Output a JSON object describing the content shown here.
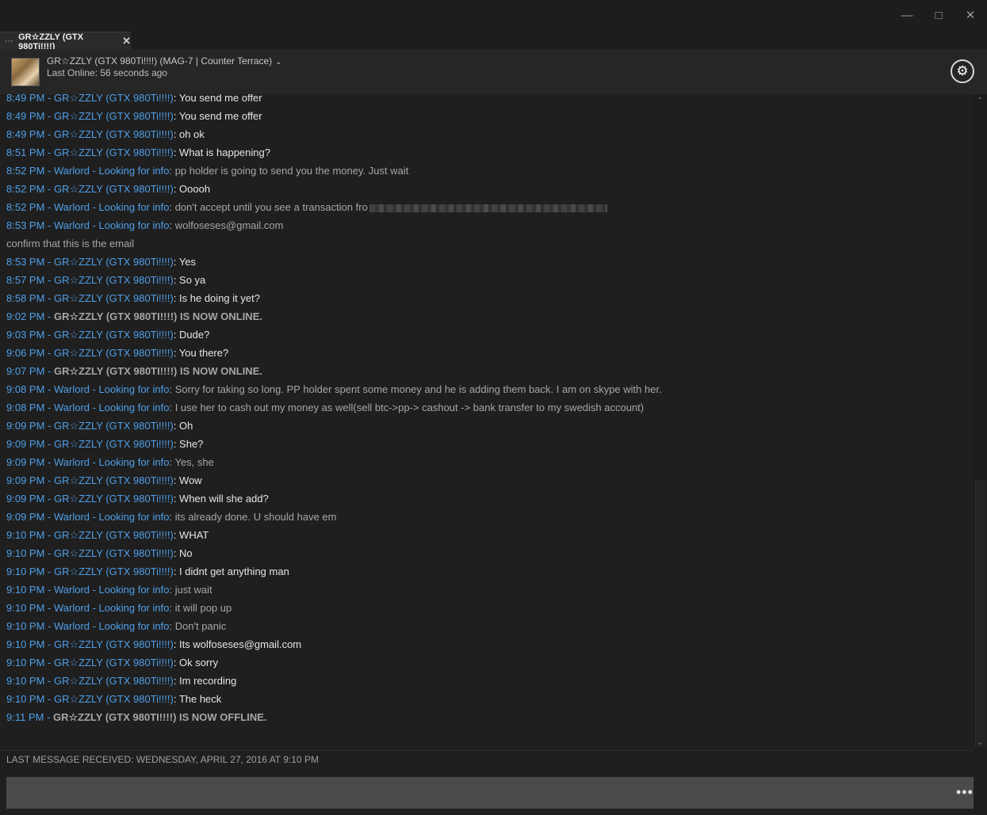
{
  "window": {
    "minimize": "—",
    "maximize": "□",
    "close": "✕"
  },
  "tab": {
    "menu": "···",
    "title": "GR☆ZZLY (GTX 980Ti!!!!)",
    "close": "✕"
  },
  "header": {
    "name": "GR☆ZZLY (GTX 980Ti!!!!) (MAG-7 | Counter Terrace)",
    "chevron": "⌄",
    "last_online": "Last Online: 56 seconds ago",
    "settings_icon": "⚙"
  },
  "messages": [
    {
      "time": "8:49 PM",
      "sender": "GR☆ZZLY (GTX 980Ti!!!!)",
      "text": "You send me offer",
      "type": "g"
    },
    {
      "time": "8:49 PM",
      "sender": "GR☆ZZLY (GTX 980Ti!!!!)",
      "text": "You send me offer",
      "type": "g"
    },
    {
      "time": "8:49 PM",
      "sender": "GR☆ZZLY (GTX 980Ti!!!!)",
      "text": "oh ok",
      "type": "g"
    },
    {
      "time": "8:51 PM",
      "sender": "GR☆ZZLY (GTX 980Ti!!!!)",
      "text": "What is happening?",
      "type": "g"
    },
    {
      "time": "8:52 PM",
      "sender": "Warlord - Looking for info",
      "text": "pp holder is going to send you the money. Just wait",
      "type": "w"
    },
    {
      "time": "8:52 PM",
      "sender": "GR☆ZZLY (GTX 980Ti!!!!)",
      "text": "Ooooh",
      "type": "g"
    },
    {
      "time": "8:52 PM",
      "sender": "Warlord - Looking for info",
      "text": "don't accept until you see a transaction fro",
      "type": "w",
      "blurred": true
    },
    {
      "time": "8:53 PM",
      "sender": "Warlord - Looking for info",
      "text": "wolfoseses@gmail.com",
      "type": "w"
    },
    {
      "cont": " confirm that this is the email"
    },
    {
      "time": "8:53 PM",
      "sender": "GR☆ZZLY (GTX 980Ti!!!!)",
      "text": "Yes",
      "type": "g"
    },
    {
      "time": "8:57 PM",
      "sender": "GR☆ZZLY (GTX 980Ti!!!!)",
      "text": "So ya",
      "type": "g"
    },
    {
      "time": "8:58 PM",
      "sender": "GR☆ZZLY (GTX 980Ti!!!!)",
      "text": "Is he doing it yet?",
      "type": "g"
    },
    {
      "time": "9:02 PM",
      "status": "GR☆ZZLY (GTX 980TI!!!!) IS NOW ONLINE."
    },
    {
      "time": "9:03 PM",
      "sender": "GR☆ZZLY (GTX 980Ti!!!!)",
      "text": "Dude?",
      "type": "g"
    },
    {
      "time": "9:06 PM",
      "sender": "GR☆ZZLY (GTX 980Ti!!!!)",
      "text": "You there?",
      "type": "g"
    },
    {
      "time": "9:07 PM",
      "status": "GR☆ZZLY (GTX 980TI!!!!) IS NOW ONLINE."
    },
    {
      "time": "9:08 PM",
      "sender": "Warlord - Looking for info",
      "text": "Sorry for taking so long. PP holder spent some money and he is adding them back. I am on skype with her.",
      "type": "w"
    },
    {
      "time": "9:08 PM",
      "sender": "Warlord - Looking for info",
      "text": "I use her to cash out my money as well(sell btc->pp-> cashout -> bank transfer to my swedish account)",
      "type": "w"
    },
    {
      "time": "9:09 PM",
      "sender": "GR☆ZZLY (GTX 980Ti!!!!)",
      "text": "Oh",
      "type": "g"
    },
    {
      "time": "9:09 PM",
      "sender": "GR☆ZZLY (GTX 980Ti!!!!)",
      "text": "She?",
      "type": "g"
    },
    {
      "time": "9:09 PM",
      "sender": "Warlord - Looking for info",
      "text": "Yes, she",
      "type": "w"
    },
    {
      "time": "9:09 PM",
      "sender": "GR☆ZZLY (GTX 980Ti!!!!)",
      "text": "Wow",
      "type": "g"
    },
    {
      "time": "9:09 PM",
      "sender": "GR☆ZZLY (GTX 980Ti!!!!)",
      "text": "When will she add?",
      "type": "g"
    },
    {
      "time": "9:09 PM",
      "sender": "Warlord - Looking for info",
      "text": "its already done. U should have em",
      "type": "w"
    },
    {
      "time": "9:10 PM",
      "sender": "GR☆ZZLY (GTX 980Ti!!!!)",
      "text": "WHAT",
      "type": "g"
    },
    {
      "time": "9:10 PM",
      "sender": "GR☆ZZLY (GTX 980Ti!!!!)",
      "text": "No",
      "type": "g"
    },
    {
      "time": "9:10 PM",
      "sender": "GR☆ZZLY (GTX 980Ti!!!!)",
      "text": "I didnt get anything man",
      "type": "g"
    },
    {
      "time": "9:10 PM",
      "sender": "Warlord - Looking for info",
      "text": "just wait",
      "type": "w"
    },
    {
      "time": "9:10 PM",
      "sender": "Warlord - Looking for info",
      "text": "it will pop up",
      "type": "w"
    },
    {
      "time": "9:10 PM",
      "sender": "Warlord - Looking for info",
      "text": "Don't panic",
      "type": "w"
    },
    {
      "time": "9:10 PM",
      "sender": "GR☆ZZLY (GTX 980Ti!!!!)",
      "text": "Its wolfoseses@gmail.com",
      "type": "g"
    },
    {
      "time": "9:10 PM",
      "sender": "GR☆ZZLY (GTX 980Ti!!!!)",
      "text": "Ok sorry",
      "type": "g"
    },
    {
      "time": "9:10 PM",
      "sender": "GR☆ZZLY (GTX 980Ti!!!!)",
      "text": "Im recording",
      "type": "g"
    },
    {
      "time": "9:10 PM",
      "sender": "GR☆ZZLY (GTX 980Ti!!!!)",
      "text": "The heck",
      "type": "g"
    },
    {
      "time": "9:11 PM",
      "status": "GR☆ZZLY (GTX 980TI!!!!) IS NOW OFFLINE."
    }
  ],
  "scrollbar": {
    "up": "⌃",
    "down": "⌄"
  },
  "footer": {
    "last_received": "LAST MESSAGE RECEIVED: WEDNESDAY, APRIL 27, 2016 AT 9:10 PM",
    "input_value": "",
    "more_icon": "•••"
  }
}
